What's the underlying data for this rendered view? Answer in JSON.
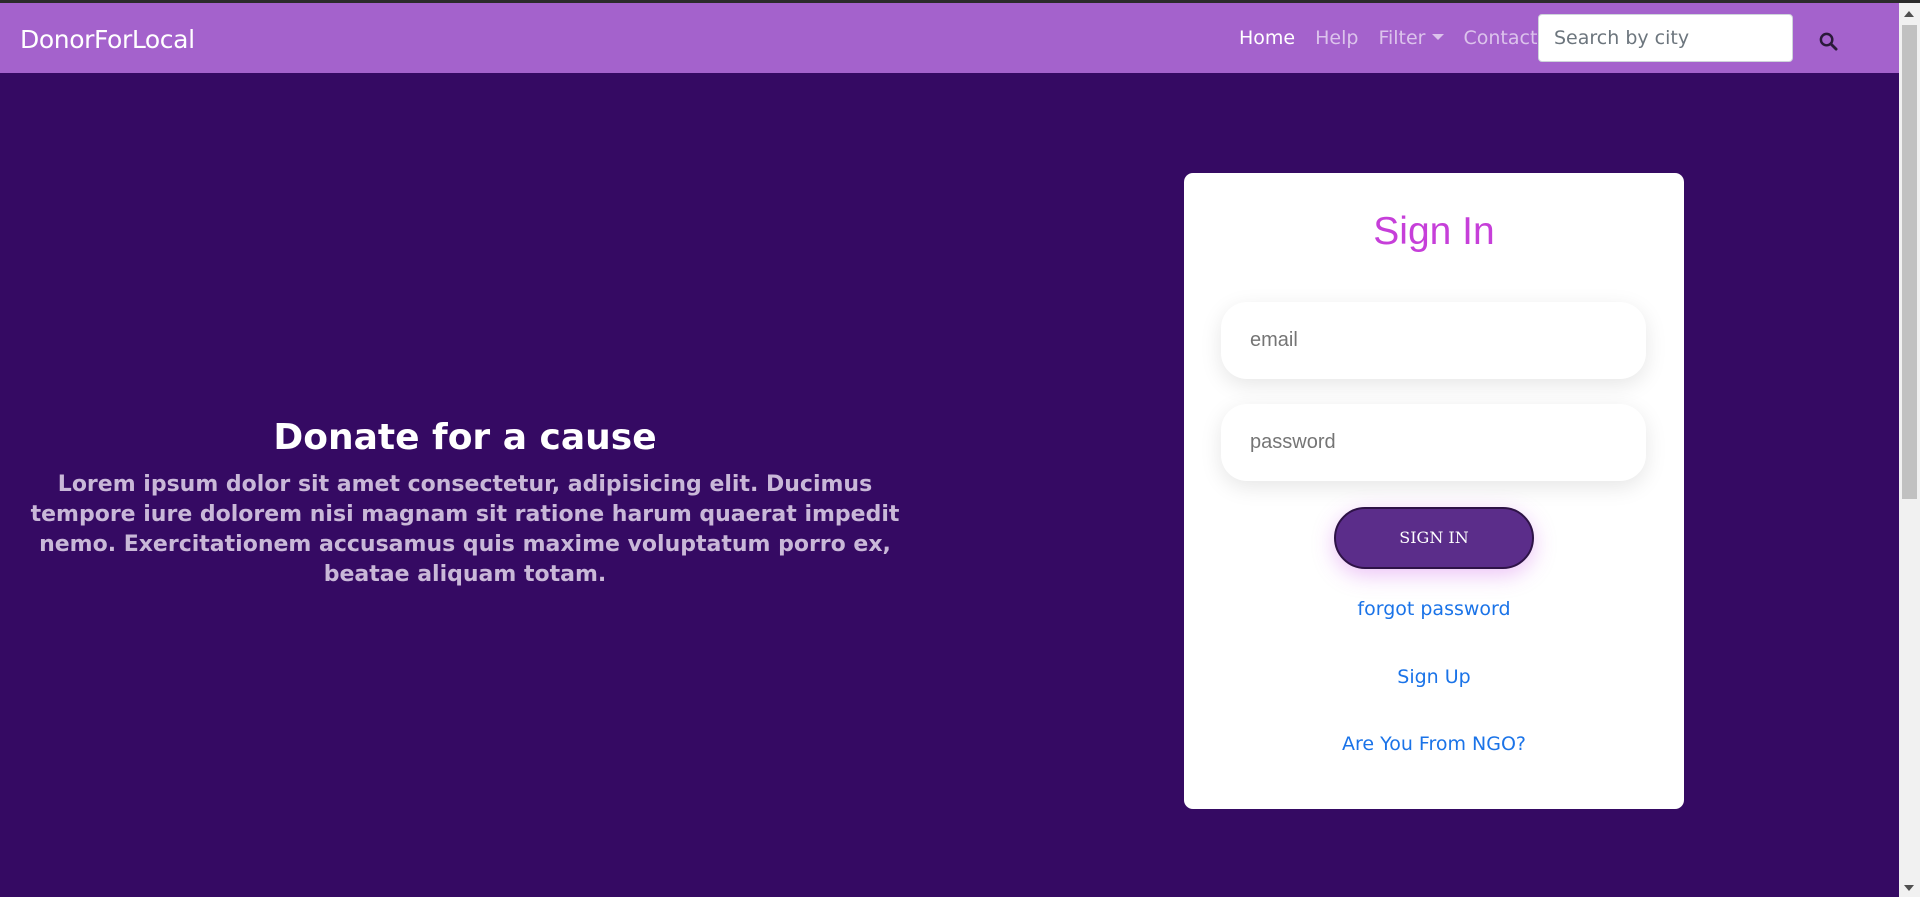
{
  "navbar": {
    "brand": "DonorForLocal",
    "links": [
      {
        "label": "Home",
        "active": true
      },
      {
        "label": "Help",
        "active": false
      },
      {
        "label": "Filter",
        "active": false,
        "dropdown": true
      },
      {
        "label": "Contact",
        "active": false
      }
    ],
    "search": {
      "placeholder": "Search by city",
      "value": ""
    },
    "search_icon": "search-icon"
  },
  "hero": {
    "title": "Donate for a cause",
    "text": "Lorem ipsum dolor sit amet consectetur, adipisicing elit. Ducimus tempore iure dolorem nisi magnam sit ratione harum quaerat impedit nemo. Exercitationem accusamus quis maxime voluptatum porro ex, beatae aliquam totam."
  },
  "signin": {
    "title": "Sign In",
    "email_placeholder": "email",
    "password_placeholder": "password",
    "button_label": "SIGN IN",
    "forgot_label": "forgot password",
    "signup_label": "Sign Up",
    "ngo_label": "Are You From NGO?"
  },
  "colors": {
    "navbar": "#a462cc",
    "background": "#350a63",
    "title_accent": "#c63fd9",
    "button": "#5b2d8a",
    "link": "#1a73e8"
  }
}
